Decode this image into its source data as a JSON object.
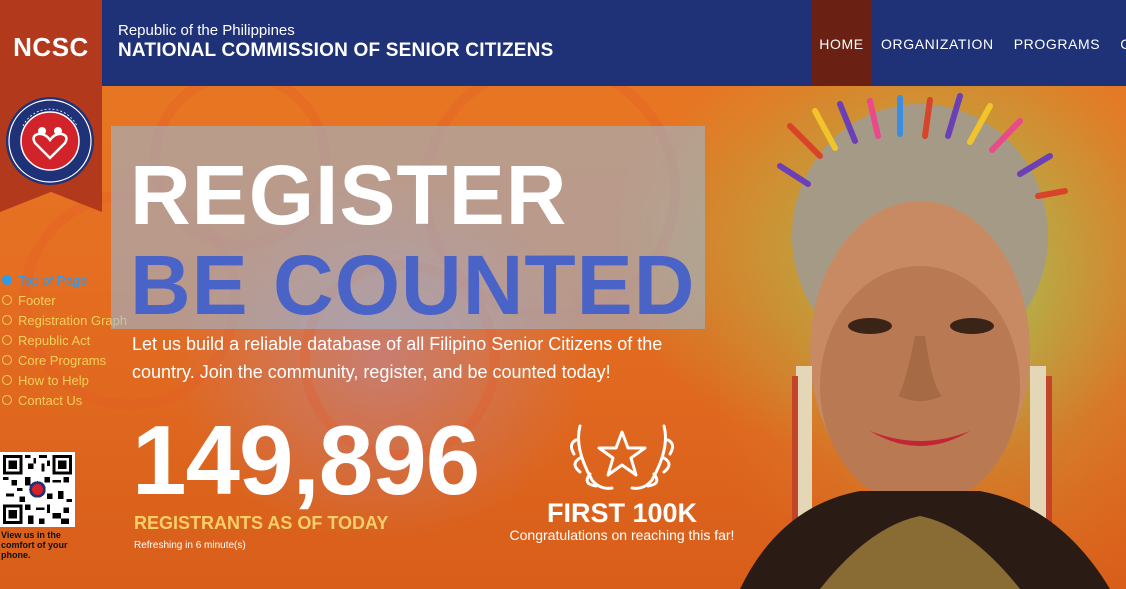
{
  "header": {
    "logo_text": "NCSC",
    "gov_line": "Republic of the Philippines",
    "agency_name": "NATIONAL COMMISSION OF SENIOR CITIZENS",
    "nav": [
      "HOME",
      "ORGANIZATION",
      "PROGRAMS",
      "CARI"
    ]
  },
  "seal": {
    "icon": "ncsc-seal-icon"
  },
  "side_nav": {
    "items": [
      {
        "label": "Top of Page",
        "active": true
      },
      {
        "label": "Footer",
        "active": false
      },
      {
        "label": "Registration Graph",
        "active": false
      },
      {
        "label": "Republic Act",
        "active": false
      },
      {
        "label": "Core Programs",
        "active": false
      },
      {
        "label": "How to Help",
        "active": false
      },
      {
        "label": "Contact Us",
        "active": false
      }
    ]
  },
  "qr": {
    "caption": "View us in the comfort of your phone."
  },
  "hero": {
    "line1": "REGISTER",
    "line2": "BE COUNTED",
    "intro": "Let us build a reliable database of all Filipino Senior Citizens of the country. Join the community, register, and be counted today!",
    "count": "149,896",
    "count_label": "REGISTRANTS AS OF TODAY",
    "refresh_text": "Refreshing in 6 minute(s)",
    "milestone": "FIRST 100K",
    "congrats": "Congratulations on reaching this far!"
  },
  "colors": {
    "nav_bg": "#1f3177",
    "brand_red": "#b2391c",
    "nav_active": "#6a2012",
    "accent_blue": "#4a63c6",
    "accent_yellow": "#f6cf6a",
    "sidenav_active": "#2a9cf0"
  }
}
